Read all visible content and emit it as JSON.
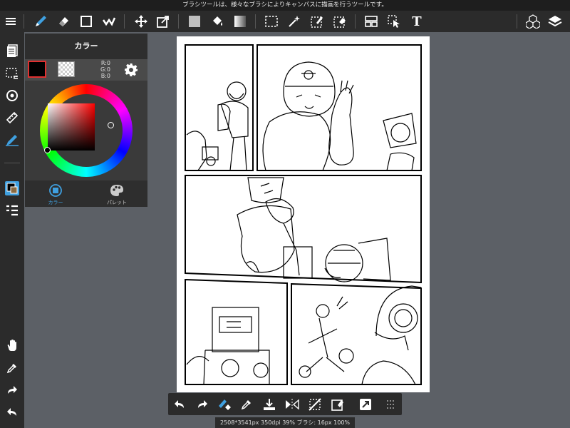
{
  "tip_text": "ブラシツールは、様々なブラシによりキャンバスに描画を行うツールです。",
  "toolbar": {
    "tools": [
      {
        "name": "menu-icon"
      },
      {
        "name": "brush-icon",
        "active": true
      },
      {
        "name": "eraser-icon"
      },
      {
        "name": "shape-icon"
      },
      {
        "name": "dot-brush-icon"
      },
      {
        "name": "move-icon"
      },
      {
        "name": "transform-icon"
      },
      {
        "name": "fill-square-icon"
      },
      {
        "name": "bucket-icon"
      },
      {
        "name": "gradient-icon"
      },
      {
        "name": "select-rect-icon"
      },
      {
        "name": "magic-wand-icon"
      },
      {
        "name": "select-pen-icon"
      },
      {
        "name": "select-eraser-icon"
      },
      {
        "name": "panel-divide-icon"
      },
      {
        "name": "operation-icon"
      },
      {
        "name": "text-icon"
      },
      {
        "name": "3d-cubes-icon"
      },
      {
        "name": "layers-icon"
      }
    ],
    "text_tool_glyph": "T"
  },
  "color_panel": {
    "title": "カラー",
    "foreground": "#000000",
    "background": "transparent",
    "r_label": "R:0",
    "g_label": "G:0",
    "b_label": "B:0",
    "tabs": [
      {
        "label": "カラー",
        "active": true
      },
      {
        "label": "パレット",
        "active": false
      }
    ]
  },
  "status_text": "2508*3541px 350dpi 39% ブラシ: 16px 100%",
  "colors": {
    "accent": "#3fa0e0",
    "selected_border": "#e03030",
    "bar_bg": "#2b2b2b",
    "workspace_bg": "#5c6066"
  }
}
